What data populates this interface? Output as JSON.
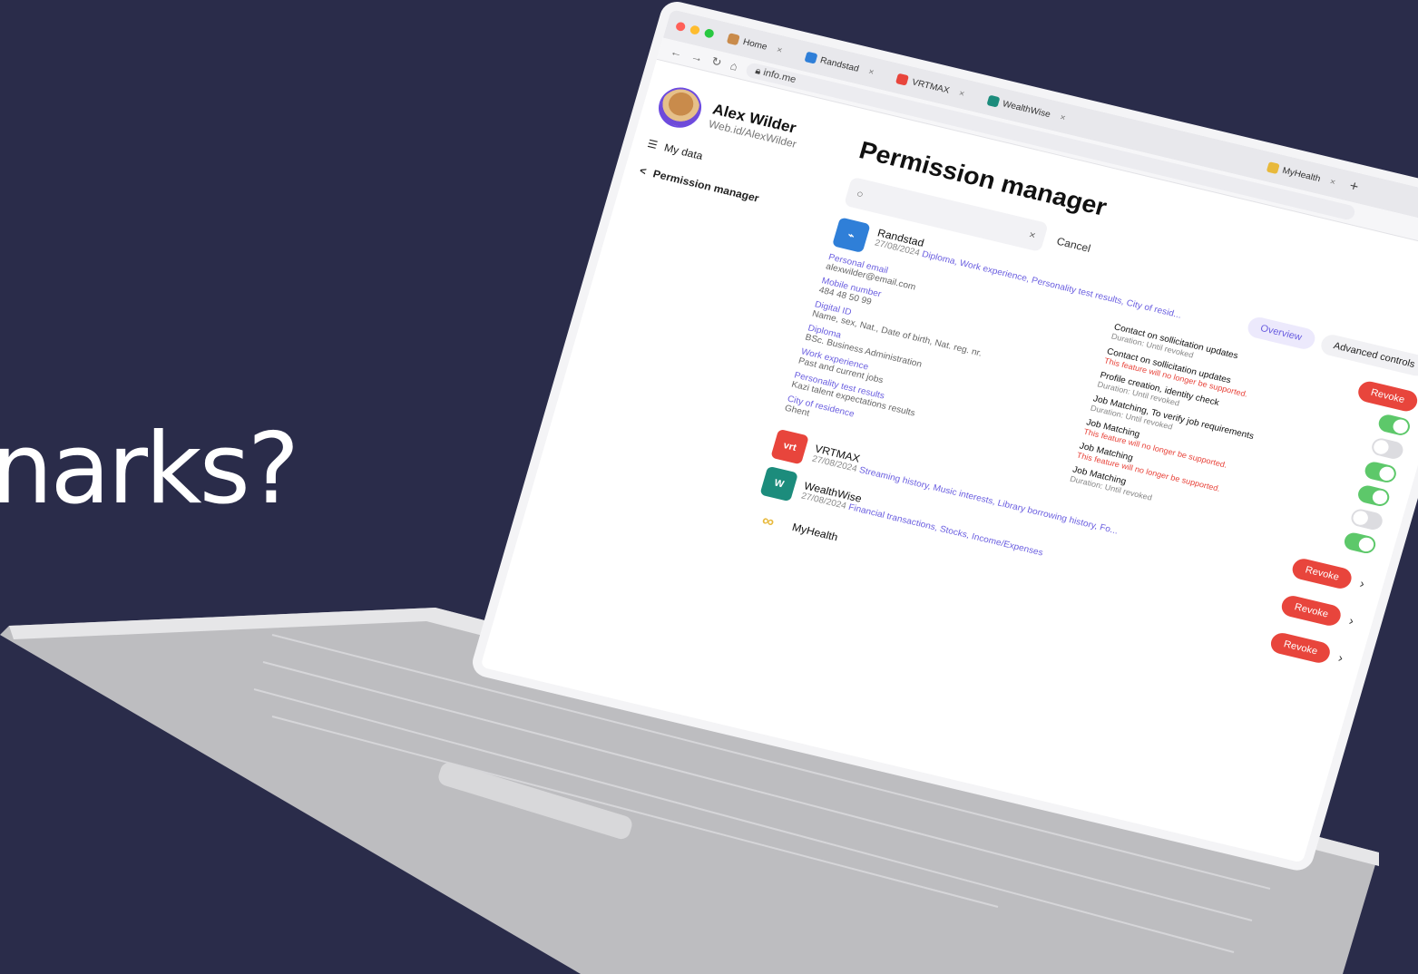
{
  "headline": "narks?",
  "browser": {
    "tabs": [
      {
        "label": "Home",
        "color": "#c98b4b"
      },
      {
        "label": "Randstad",
        "color": "#2f7fd8"
      },
      {
        "label": "VRTMAX",
        "color": "#e8453c"
      },
      {
        "label": "WealthWise",
        "color": "#1c8c7c"
      },
      {
        "label": "MyHealth",
        "color": "#e8b93c"
      }
    ],
    "new_tab": "+",
    "url": "info.me"
  },
  "sidebar": {
    "name": "Alex Wilder",
    "handle": "Web.id/AlexWilder",
    "items": [
      {
        "label": "My data",
        "icon": "database-icon"
      },
      {
        "label": "Permission manager",
        "icon": "share-icon"
      }
    ]
  },
  "main": {
    "title": "Permission manager",
    "search_close": "×",
    "cancel": "Cancel",
    "tabs": {
      "overview": "Overview",
      "advanced": "Advanced controls"
    },
    "randstad": {
      "name": "Randstad",
      "date": "27/08/2024",
      "cats": "Diploma, Work experience, Personality test results, City of resid...",
      "revoke": "Revoke",
      "fields": [
        {
          "label": "Personal email",
          "value": "alexwilder@email.com"
        },
        {
          "label": "Mobile number",
          "value": "484 48 50 99"
        },
        {
          "label": "Digital ID",
          "value": "Name, sex, Nat., Date of birth, Nat. reg. nr."
        },
        {
          "label": "Diploma",
          "value": "BSc. Business Administration"
        },
        {
          "label": "Work experience",
          "value": "Past and current jobs"
        },
        {
          "label": "Personality test results",
          "value": "Kazi talent expectations results"
        },
        {
          "label": "City of residence",
          "value": "Ghent"
        }
      ],
      "perms": [
        {
          "title": "Contact on sollicitation updates",
          "sub": "Duration: Until revoked",
          "warn": false,
          "on": true
        },
        {
          "title": "Contact on sollicitation updates",
          "sub": "This feature will no longer be supported.",
          "warn": true,
          "on": false
        },
        {
          "title": "Profile creation, identity check",
          "sub": "Duration: Until revoked",
          "warn": false,
          "on": true
        },
        {
          "title": "Job Matching, To verify job requirements",
          "sub": "Duration: Until revoked",
          "warn": false,
          "on": true
        },
        {
          "title": "Job Matching",
          "sub": "This feature will no longer be supported.",
          "warn": true,
          "on": false
        },
        {
          "title": "Job Matching",
          "sub": "This feature will no longer be supported.",
          "warn": true,
          "on": false
        },
        {
          "title": "Job Matching",
          "sub": "Duration: Until revoked",
          "warn": false,
          "on": true
        }
      ]
    },
    "others": [
      {
        "name": "VRTMAX",
        "date": "27/08/2024",
        "cats": "Streaming history, Music interests, Library borrowing history, Fo...",
        "logo": "vrt",
        "color": "#e8453c",
        "revoke": "Revoke"
      },
      {
        "name": "WealthWise",
        "date": "27/08/2024",
        "cats": "Financial transactions, Stocks, Income/Expenses",
        "logo": "W",
        "color": "#1c8c7c",
        "revoke": "Revoke"
      },
      {
        "name": "MyHealth",
        "date": "",
        "cats": "",
        "logo": "∞",
        "color": "#e8b93c",
        "revoke": "Revoke"
      }
    ]
  }
}
